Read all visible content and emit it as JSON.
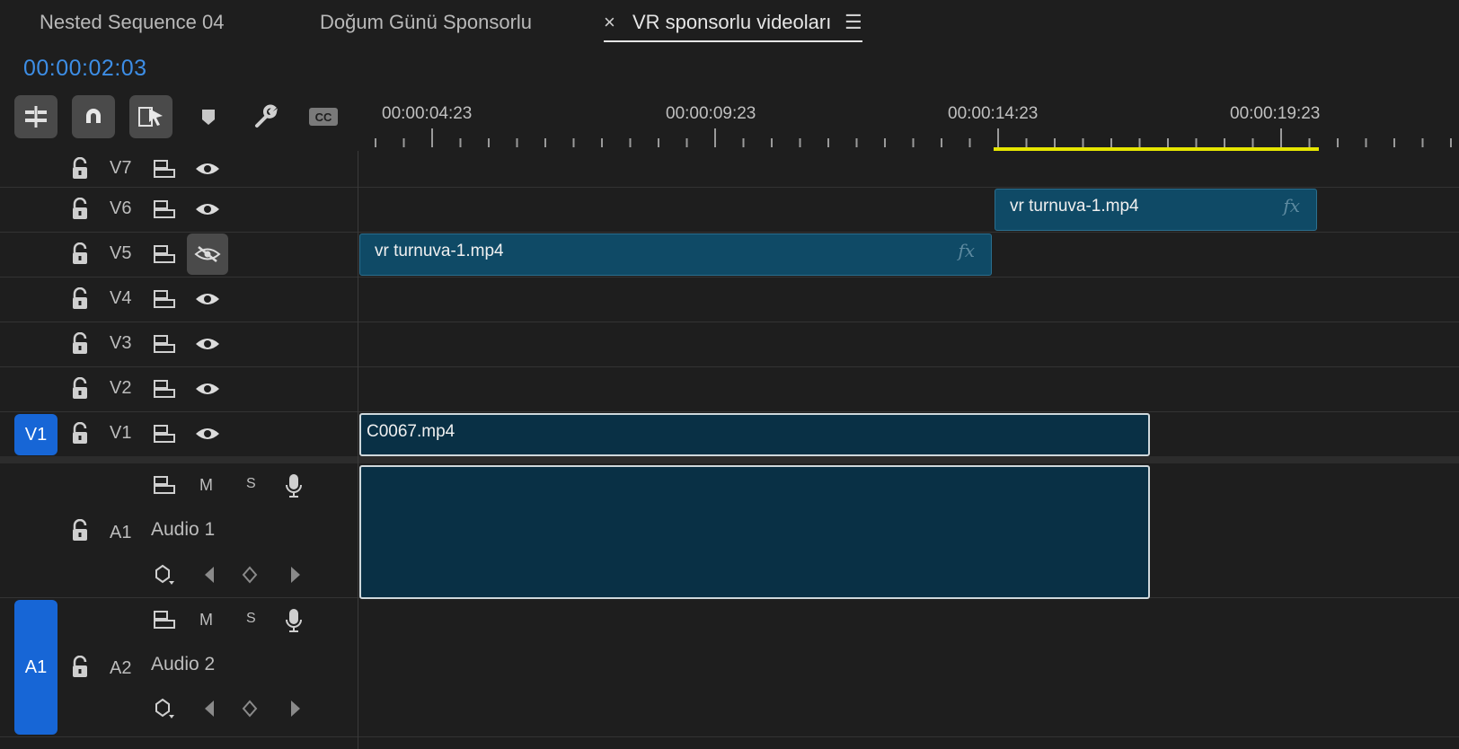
{
  "tabs": [
    {
      "label": "Nested Sequence 04"
    },
    {
      "label": "Doğum Günü Sponsorlu"
    },
    {
      "label": "VR sponsorlu videoları",
      "close": "×",
      "menu": "☰"
    }
  ],
  "timecode": "00:00:02:03",
  "ruler": {
    "labels": [
      "00:00:04:23",
      "00:00:09:23",
      "00:00:14:23",
      "00:00:19:23"
    ],
    "work_area_color": "#e6e600"
  },
  "tools": [
    "insert-and-overwrite-sequences-icon",
    "snap-magnet-icon",
    "linked-selection-icon",
    "add-marker-icon",
    "timeline-settings-wrench-icon",
    "captions-icon"
  ],
  "video_tracks": [
    {
      "id": "V7",
      "visible": true
    },
    {
      "id": "V6",
      "visible": true
    },
    {
      "id": "V5",
      "visible": false
    },
    {
      "id": "V4",
      "visible": true
    },
    {
      "id": "V3",
      "visible": true
    },
    {
      "id": "V2",
      "visible": true
    },
    {
      "id": "V1",
      "visible": true,
      "source_patch": "V1"
    }
  ],
  "audio_tracks": [
    {
      "id": "A1",
      "name": "Audio 1",
      "m": "M",
      "s": "S"
    },
    {
      "id": "A2",
      "name": "Audio 2",
      "m": "M",
      "s": "S",
      "source_patch": "A1"
    }
  ],
  "clips": {
    "v6": {
      "name": "vr turnuva-1.mp4",
      "fx": "fx"
    },
    "v5": {
      "name": "vr turnuva-1.mp4",
      "fx": "fx"
    },
    "v1": {
      "name": "C0067.mp4"
    }
  },
  "colors": {
    "accent": "#3d8ee6",
    "clip": "#0f4a66",
    "audio_clip": "#093045",
    "source_patch": "#1766d6"
  }
}
